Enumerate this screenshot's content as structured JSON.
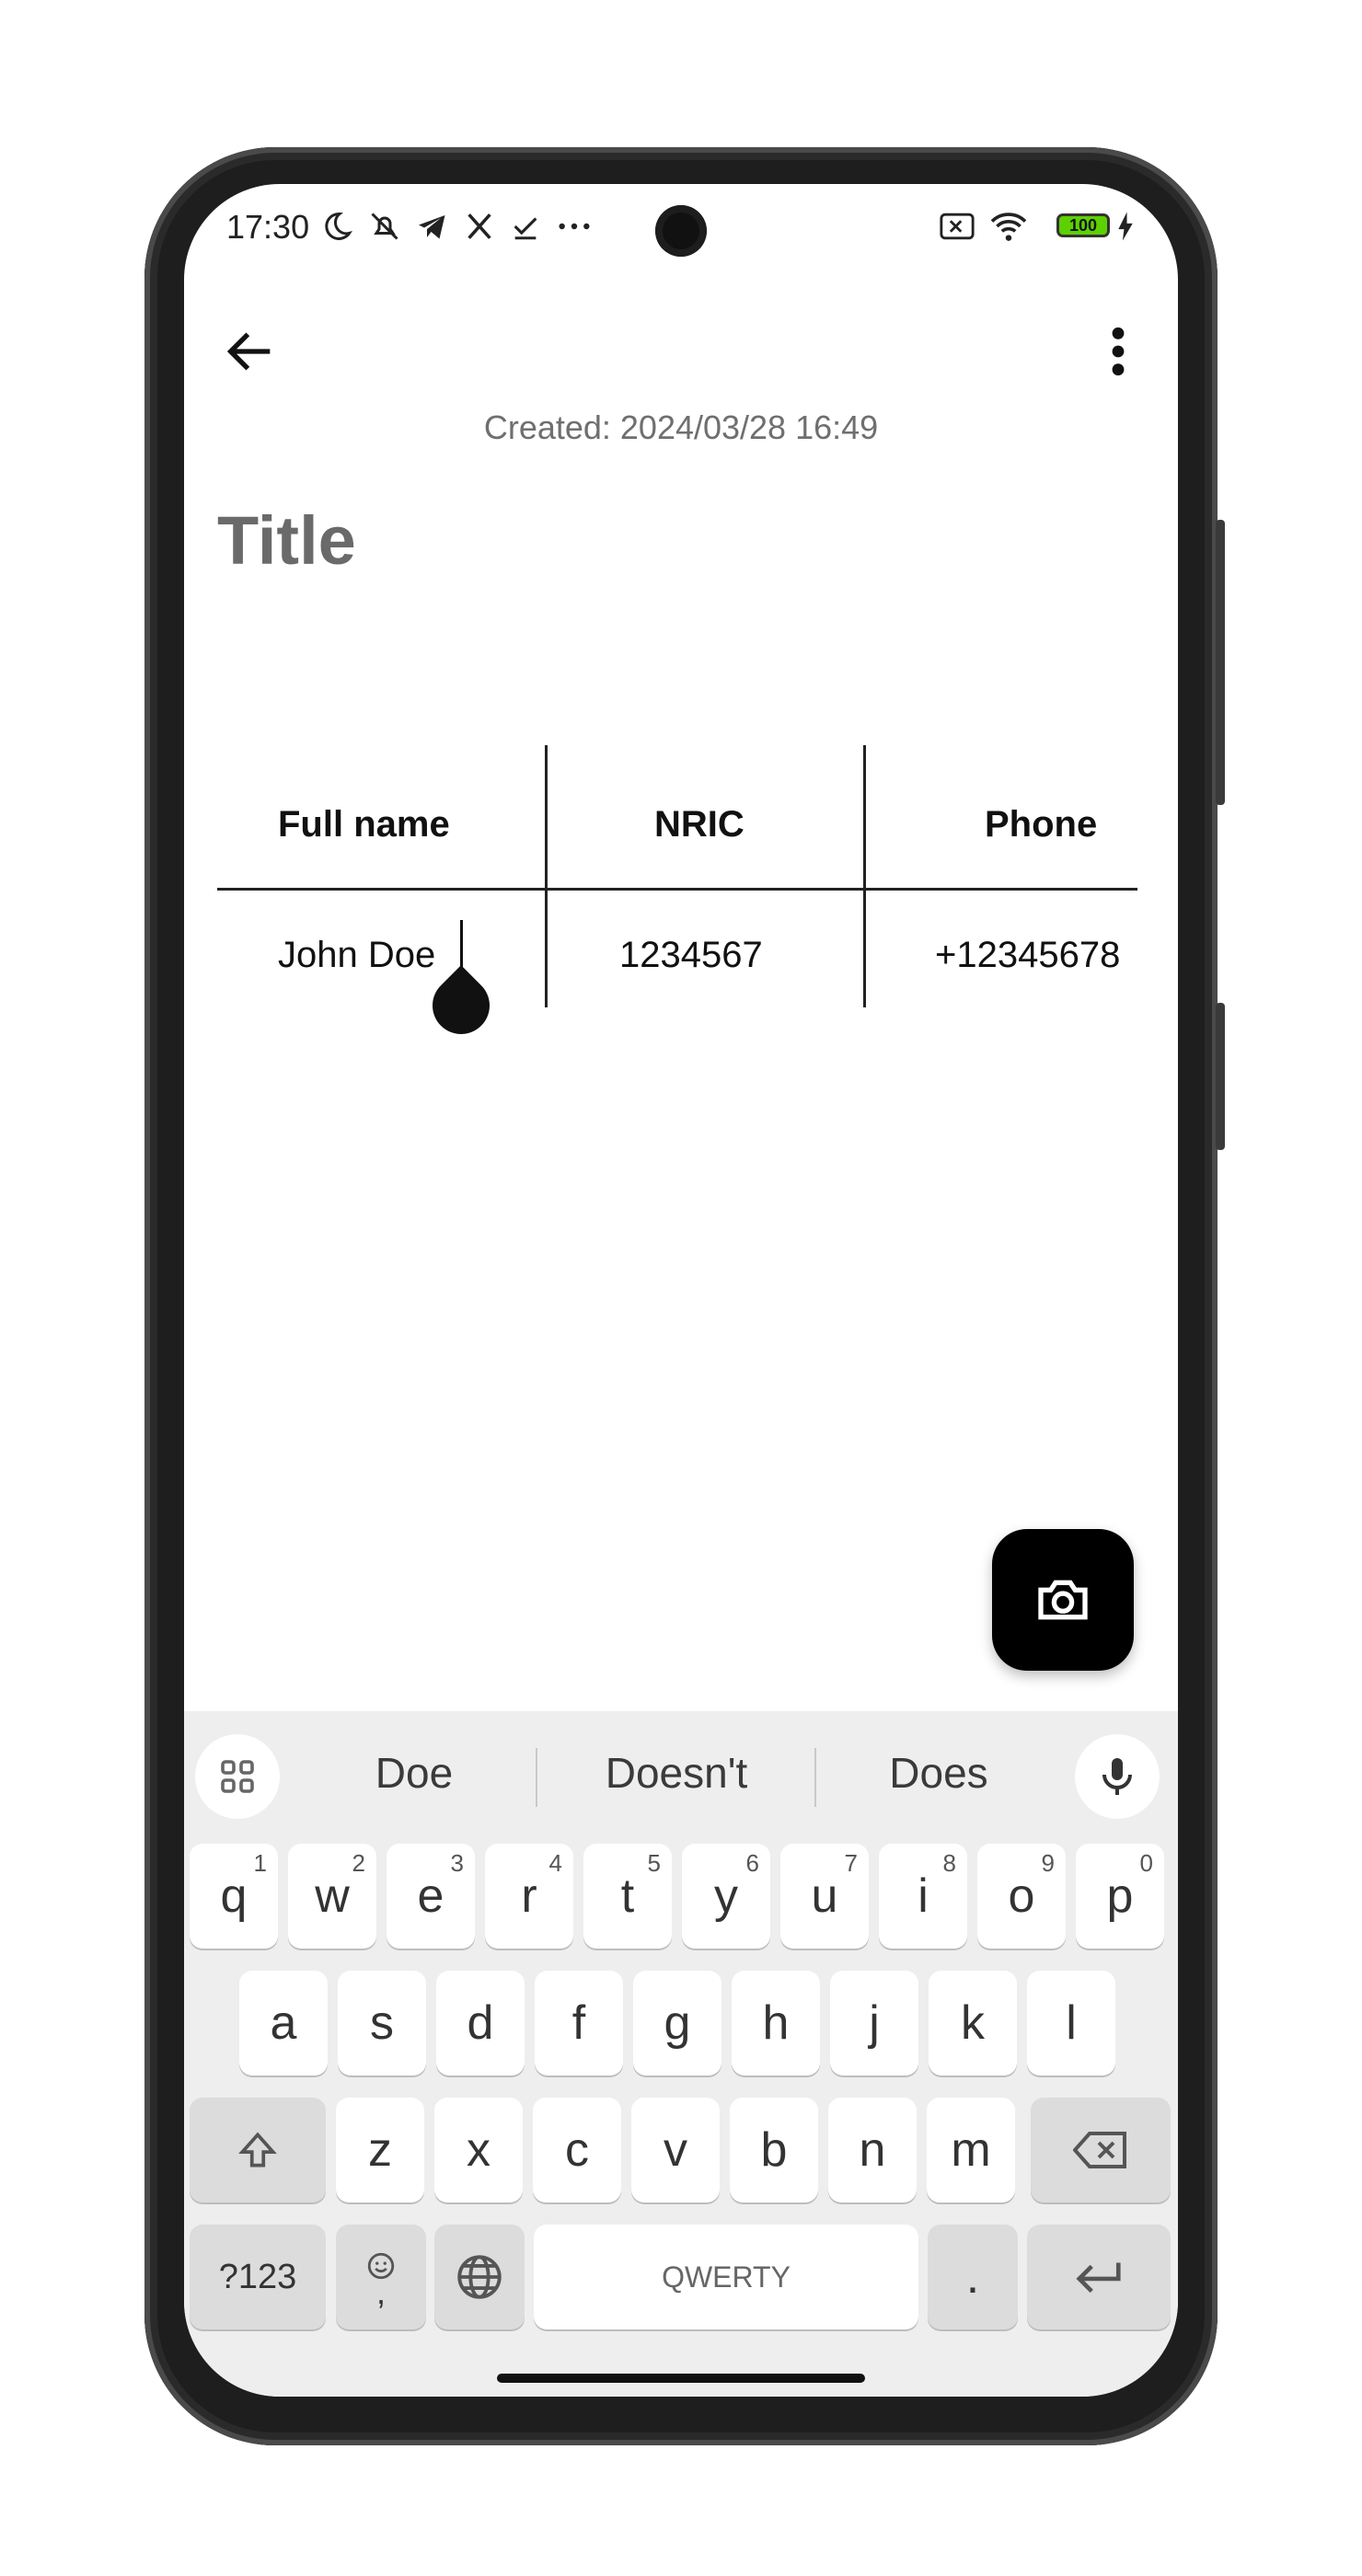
{
  "status_bar": {
    "time": "17:30",
    "icons_left": [
      "moon-icon",
      "silent-icon",
      "telegram-icon",
      "x-icon",
      "check-icon",
      "more-icon"
    ],
    "icons_right": [
      "sim-off-icon",
      "wifi-icon",
      "battery-icon",
      "charging-icon"
    ],
    "battery": "100"
  },
  "header": {
    "created": "Created: 2024/03/28 16:49"
  },
  "note": {
    "title": "Title"
  },
  "table": {
    "headers": [
      "Full name",
      "NRIC",
      "Phone"
    ],
    "rows": [
      [
        "John Doe",
        "1234567",
        "+12345678"
      ]
    ]
  },
  "keyboard": {
    "suggestions": [
      "Doe",
      "Doesn't",
      "Does"
    ],
    "row1": [
      {
        "k": "q",
        "h": "1"
      },
      {
        "k": "w",
        "h": "2"
      },
      {
        "k": "e",
        "h": "3"
      },
      {
        "k": "r",
        "h": "4"
      },
      {
        "k": "t",
        "h": "5"
      },
      {
        "k": "y",
        "h": "6"
      },
      {
        "k": "u",
        "h": "7"
      },
      {
        "k": "i",
        "h": "8"
      },
      {
        "k": "o",
        "h": "9"
      },
      {
        "k": "p",
        "h": "0"
      }
    ],
    "row2": [
      "a",
      "s",
      "d",
      "f",
      "g",
      "h",
      "j",
      "k",
      "l"
    ],
    "row3": [
      "z",
      "x",
      "c",
      "v",
      "b",
      "n",
      "m"
    ],
    "symbols_key": "?123",
    "emoji_key_sub": ",",
    "space_label": "QWERTY",
    "period_key": "."
  },
  "accent": "#000000"
}
